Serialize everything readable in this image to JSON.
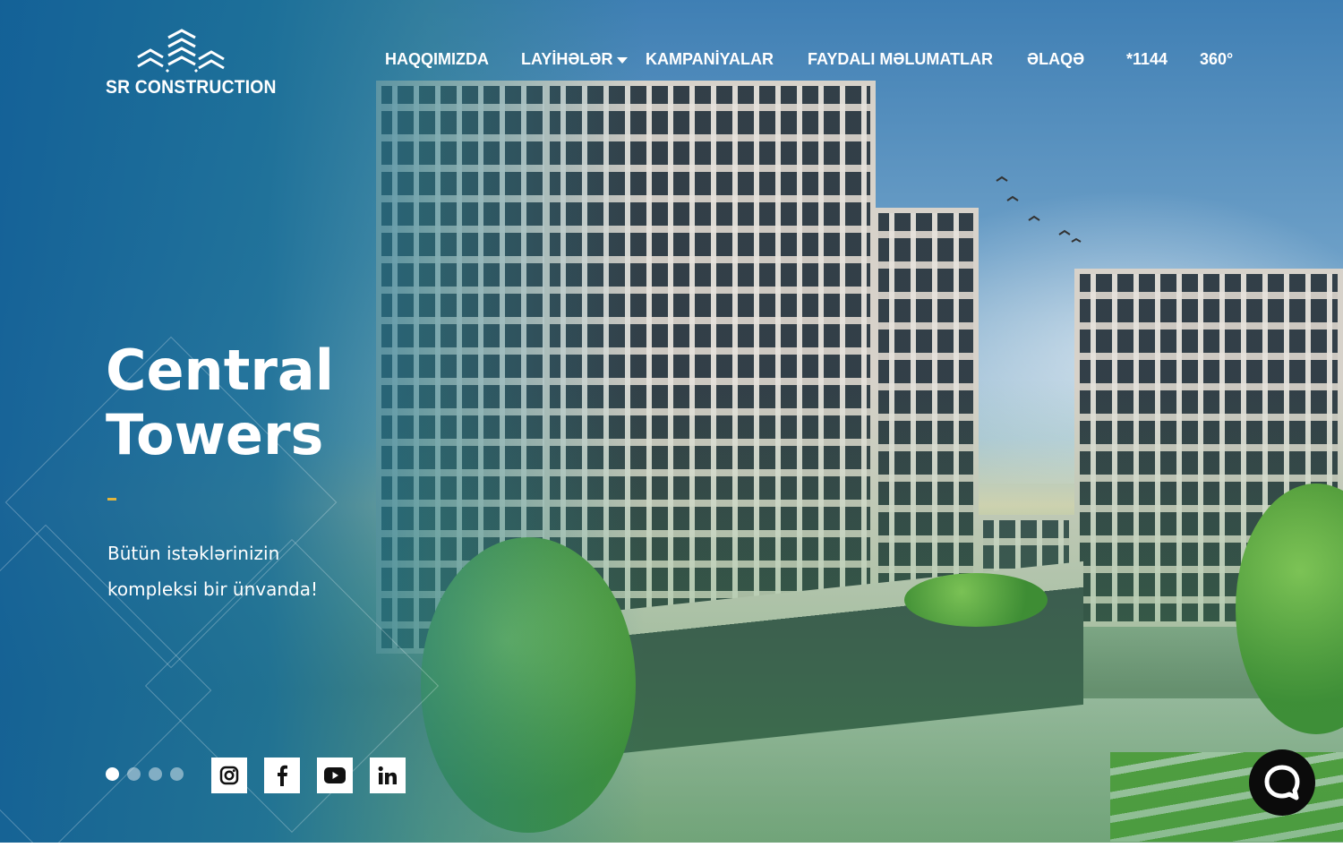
{
  "brand": {
    "name": "SR CONSTRUCTION"
  },
  "nav": {
    "items": [
      {
        "label": "HAQQIMIZDA"
      },
      {
        "label": "LAYİHƏLƏR",
        "has_dropdown": true
      },
      {
        "label": "KAMPANİYALAR"
      },
      {
        "label": "FAYDALI MƏLUMATLAR"
      },
      {
        "label": "ƏLAQƏ"
      },
      {
        "label": "*1144"
      },
      {
        "label": "360°"
      }
    ]
  },
  "hero": {
    "title": "Central Towers",
    "subtitle": "Bütün istəklərinizin kompleksi bir ünvanda!",
    "accent_color": "#e3b53c"
  },
  "slider": {
    "slides_total": 4,
    "active_slide": 1
  },
  "social": [
    {
      "name": "instagram-icon"
    },
    {
      "name": "facebook-icon"
    },
    {
      "name": "youtube-icon"
    },
    {
      "name": "linkedin-icon"
    }
  ],
  "chat": {
    "icon": "chat-bubble-icon"
  },
  "colors": {
    "overlay_blue": "#12609a",
    "overlay_green": "#3c9646",
    "chat_bg": "#0b0b0b"
  }
}
